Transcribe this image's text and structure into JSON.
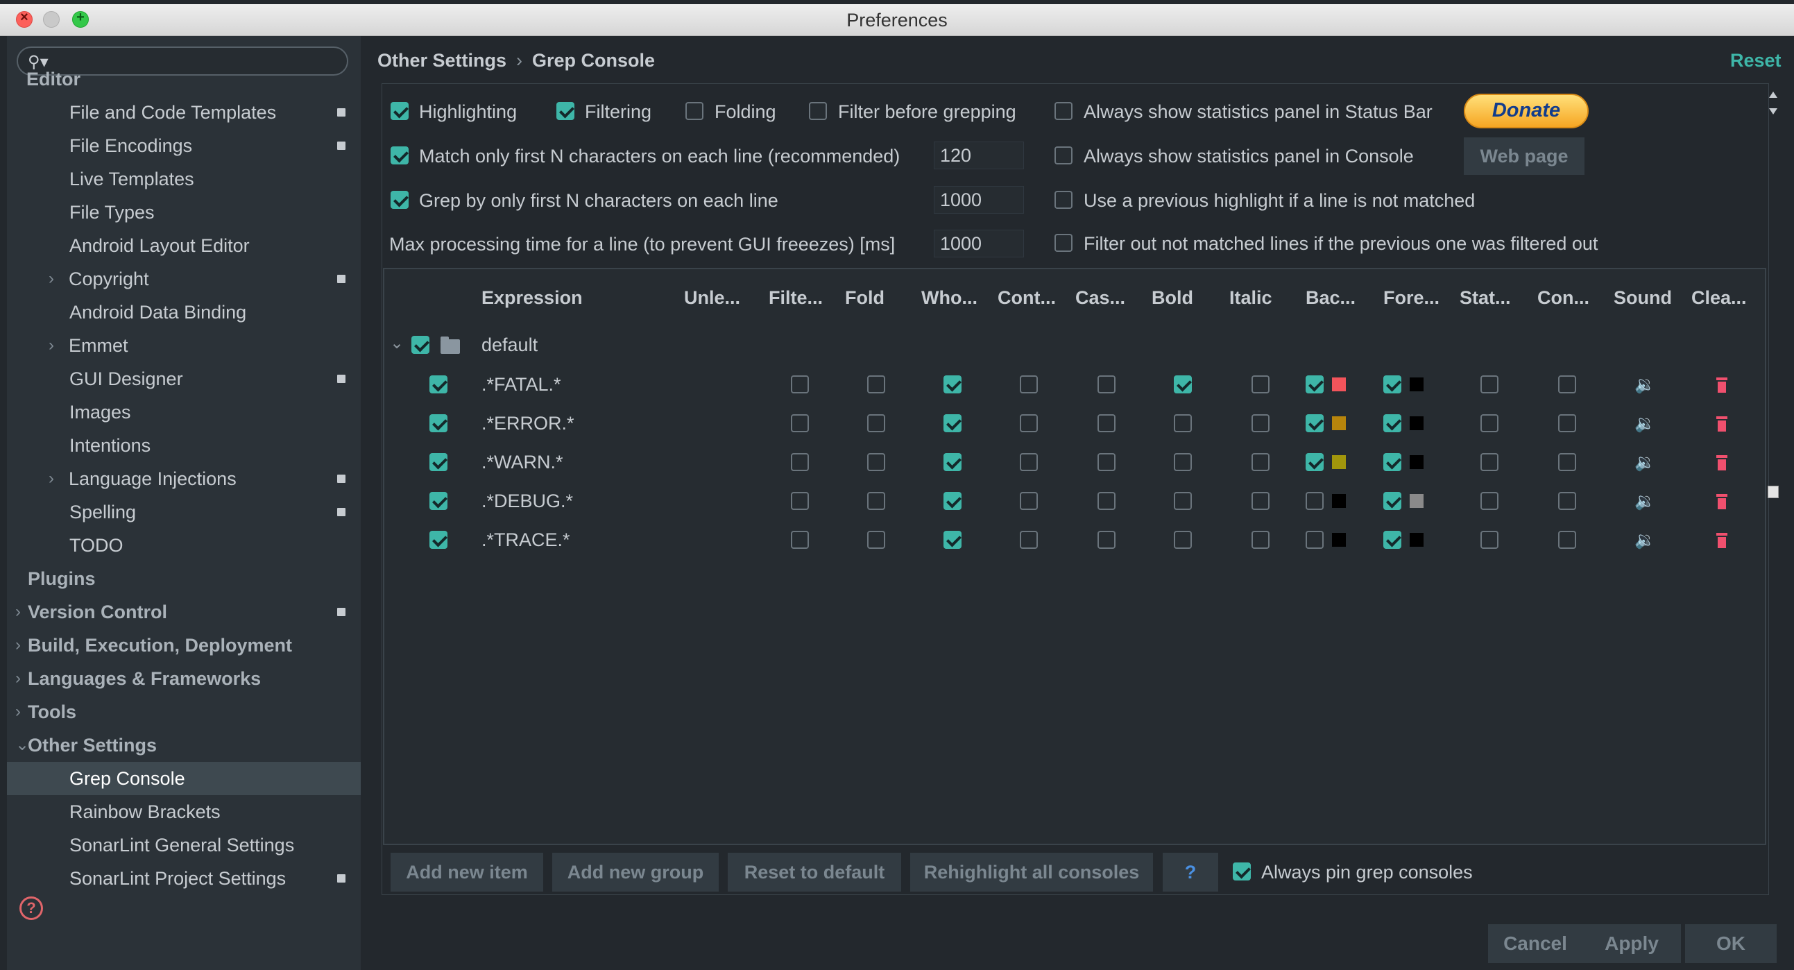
{
  "window": {
    "title": "Preferences"
  },
  "search": {
    "placeholder": ""
  },
  "sidebar": {
    "items": [
      {
        "label": "Editor",
        "level": 0,
        "header": true
      },
      {
        "label": "File and Code Templates",
        "level": 1,
        "badge": true
      },
      {
        "label": "File Encodings",
        "level": 1,
        "badge": true
      },
      {
        "label": "Live Templates",
        "level": 1
      },
      {
        "label": "File Types",
        "level": 1
      },
      {
        "label": "Android Layout Editor",
        "level": 1
      },
      {
        "label": "Copyright",
        "level": 1,
        "expandable": true,
        "badge": true
      },
      {
        "label": "Android Data Binding",
        "level": 1
      },
      {
        "label": "Emmet",
        "level": 1,
        "expandable": true
      },
      {
        "label": "GUI Designer",
        "level": 1,
        "badge": true
      },
      {
        "label": "Images",
        "level": 1
      },
      {
        "label": "Intentions",
        "level": 1
      },
      {
        "label": "Language Injections",
        "level": 1,
        "expandable": true,
        "badge": true
      },
      {
        "label": "Spelling",
        "level": 1,
        "badge": true
      },
      {
        "label": "TODO",
        "level": 1
      },
      {
        "label": "Plugins",
        "level": 0,
        "header": true
      },
      {
        "label": "Version Control",
        "level": 0,
        "header": true,
        "expandable": true,
        "badge": true
      },
      {
        "label": "Build, Execution, Deployment",
        "level": 0,
        "header": true,
        "expandable": true
      },
      {
        "label": "Languages & Frameworks",
        "level": 0,
        "header": true,
        "expandable": true
      },
      {
        "label": "Tools",
        "level": 0,
        "header": true,
        "expandable": true
      },
      {
        "label": "Other Settings",
        "level": 0,
        "header": true,
        "expanded": true
      },
      {
        "label": "Grep Console",
        "level": 1,
        "selected": true
      },
      {
        "label": "Rainbow Brackets",
        "level": 1
      },
      {
        "label": "SonarLint General Settings",
        "level": 1
      },
      {
        "label": "SonarLint Project Settings",
        "level": 1,
        "badge": true
      }
    ]
  },
  "breadcrumb": {
    "parent": "Other Settings",
    "separator": "›",
    "current": "Grep Console"
  },
  "reset_label": "Reset",
  "options": {
    "highlighting": {
      "label": "Highlighting",
      "checked": true
    },
    "filtering": {
      "label": "Filtering",
      "checked": true
    },
    "folding": {
      "label": "Folding",
      "checked": false
    },
    "filter_before": {
      "label": "Filter before grepping",
      "checked": false
    },
    "stats_status": {
      "label": "Always show statistics panel in Status Bar",
      "checked": false
    },
    "match_first": {
      "label": "Match only first N characters on each line (recommended)",
      "checked": true,
      "value": "120"
    },
    "stats_console": {
      "label": "Always show statistics panel in Console",
      "checked": false
    },
    "grep_first": {
      "label": "Grep by only first N characters on each line",
      "checked": true,
      "value": "1000"
    },
    "prev_highlight": {
      "label": "Use a previous highlight if a line is not matched",
      "checked": false
    },
    "max_time": {
      "label": "Max processing time for a line (to prevent GUI freeezes) [ms]",
      "value": "1000"
    },
    "filter_out": {
      "label": "Filter out not matched lines if the previous one was filtered out",
      "checked": false
    }
  },
  "donate_label": "Donate",
  "webpage_label": "Web page",
  "table": {
    "headers": [
      "Expression",
      "Unle...",
      "Filte...",
      "Fold",
      "Who...",
      "Cont...",
      "Cas...",
      "Bold",
      "Italic",
      "Bac...",
      "Fore...",
      "Stat...",
      "Con...",
      "Sound",
      "Clea..."
    ],
    "group": {
      "label": "default",
      "checked": true,
      "expanded": true
    },
    "rows": [
      {
        "expression": ".*FATAL.*",
        "enabled": true,
        "unless": false,
        "filter": false,
        "fold": false,
        "whole": true,
        "cont": false,
        "case": false,
        "bold": true,
        "italic": false,
        "bg_on": true,
        "bg": "#f2545b",
        "fg_on": true,
        "fg": "#000000",
        "stat": false,
        "con": false
      },
      {
        "expression": ".*ERROR.*",
        "enabled": true,
        "unless": false,
        "filter": false,
        "fold": false,
        "whole": true,
        "cont": false,
        "case": false,
        "bold": false,
        "italic": false,
        "bg_on": true,
        "bg": "#b7850c",
        "fg_on": true,
        "fg": "#000000",
        "stat": false,
        "con": false
      },
      {
        "expression": ".*WARN.*",
        "enabled": true,
        "unless": false,
        "filter": false,
        "fold": false,
        "whole": true,
        "cont": false,
        "case": false,
        "bold": false,
        "italic": false,
        "bg_on": true,
        "bg": "#a1960c",
        "fg_on": true,
        "fg": "#000000",
        "stat": false,
        "con": false
      },
      {
        "expression": ".*DEBUG.*",
        "enabled": true,
        "unless": false,
        "filter": false,
        "fold": false,
        "whole": true,
        "cont": false,
        "case": false,
        "bold": false,
        "italic": false,
        "bg_on": false,
        "bg": "#000000",
        "fg_on": true,
        "fg": "#8a8a8a",
        "stat": false,
        "con": false
      },
      {
        "expression": ".*TRACE.*",
        "enabled": true,
        "unless": false,
        "filter": false,
        "fold": false,
        "whole": true,
        "cont": false,
        "case": false,
        "bold": false,
        "italic": false,
        "bg_on": false,
        "bg": "#000000",
        "fg_on": true,
        "fg": "#000000",
        "stat": false,
        "con": false
      }
    ]
  },
  "bottom_buttons": {
    "add_item": "Add new item",
    "add_group": "Add new group",
    "reset_default": "Reset to default",
    "rehighlight": "Rehighlight all consoles",
    "help": "?",
    "pin_label": "Always pin grep consoles",
    "pin_checked": true
  },
  "footer": {
    "cancel": "Cancel",
    "apply": "Apply",
    "ok": "OK"
  },
  "colors": {
    "accent": "#3eb6a8",
    "background": "#23282d",
    "sidebar": "#2b3238",
    "danger": "#f0506e"
  }
}
